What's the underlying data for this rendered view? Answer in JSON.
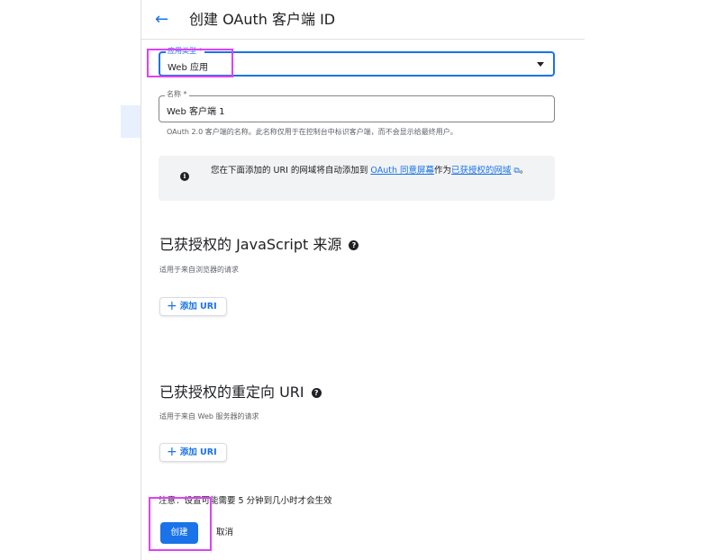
{
  "header": {
    "back_icon": "arrow-left-icon",
    "title": "创建 OAuth 客户端 ID"
  },
  "app_type": {
    "label": "应用类型 *",
    "value": "Web 应用"
  },
  "name": {
    "label": "名称 *",
    "value": "Web 客户端 1",
    "hint": "OAuth 2.0 客户端的名称。此名称仅用于在控制台中标识客户端，而不会显示给最终用户。"
  },
  "info": {
    "text_before": "您在下面添加的 URI 的网域将自动添加到 ",
    "consent_link": "OAuth 同意屏幕",
    "text_middle": "作为",
    "domains_link": "已获授权的网域",
    "text_after": "。"
  },
  "js_origins": {
    "title": "已获授权的 JavaScript 来源",
    "description": "适用于来自浏览器的请求",
    "add_label": "添加 URI"
  },
  "redirect_uris": {
    "title": "已获授权的重定向 URI",
    "description": "适用于来自 Web 服务器的请求",
    "add_label": "添加 URI"
  },
  "note": "注意：设置可能需要 5 分钟到几小时才会生效",
  "actions": {
    "create_label": "创建",
    "cancel_label": "取消"
  },
  "colors": {
    "primary": "#1a73e8",
    "highlight": "#e040fb"
  }
}
